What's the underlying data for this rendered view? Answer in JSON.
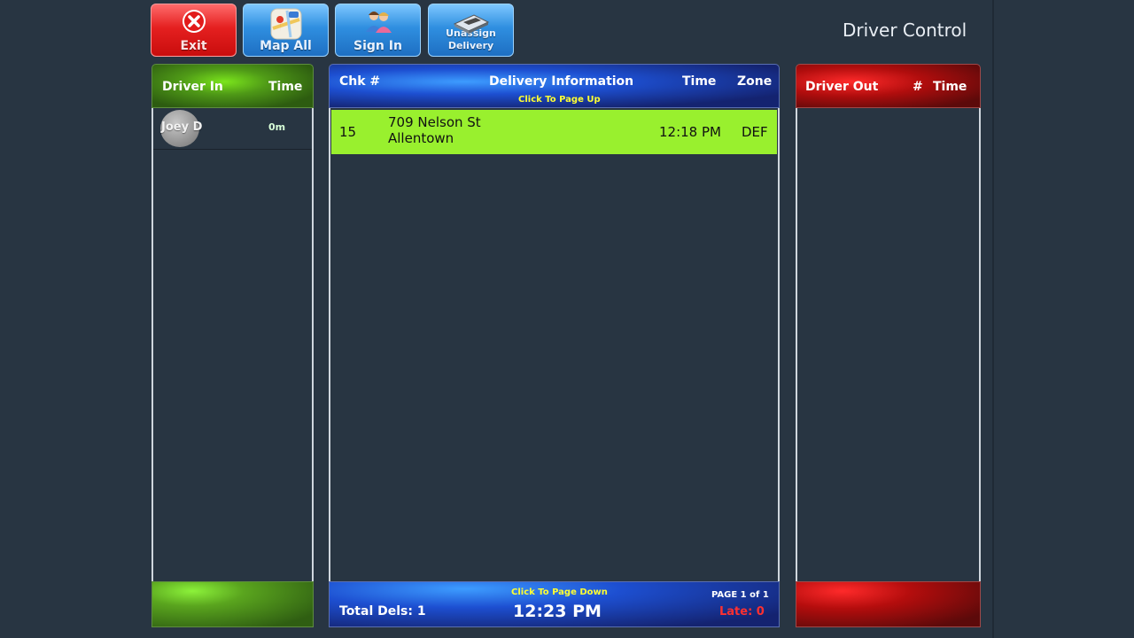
{
  "toolbar": {
    "exit_label": "Exit",
    "map_all_label": "Map All",
    "sign_in_label": "Sign In",
    "unassign_label_line1": "Unassign",
    "unassign_label_line2": "Delivery"
  },
  "app_title": "Driver Control",
  "driver_in": {
    "header_label": "Driver In",
    "header_time": "Time",
    "drivers": [
      {
        "name": "Joey D",
        "time": "0m"
      }
    ]
  },
  "deliveries": {
    "header_chk": "Chk #",
    "header_info": "Delivery Information",
    "header_page_up": "Click To Page Up",
    "header_time": "Time",
    "header_zone": "Zone",
    "rows": [
      {
        "chk": "15",
        "address_line1": "709 Nelson St",
        "address_line2": "Allentown",
        "time": "12:18 PM",
        "zone": "DEF"
      }
    ],
    "footer_page_down": "Click To Page Down",
    "footer_total": "Total Dels: 1",
    "footer_clock": "12:23 PM",
    "footer_page": "PAGE 1 of 1",
    "footer_late": "Late: 0"
  },
  "driver_out": {
    "header_label": "Driver Out",
    "header_num": "#",
    "header_time": "Time"
  },
  "colors": {
    "background": "#283542",
    "delivery_row": "#99f02e",
    "late_text": "#ff3030",
    "page_hint": "#ffff33"
  }
}
